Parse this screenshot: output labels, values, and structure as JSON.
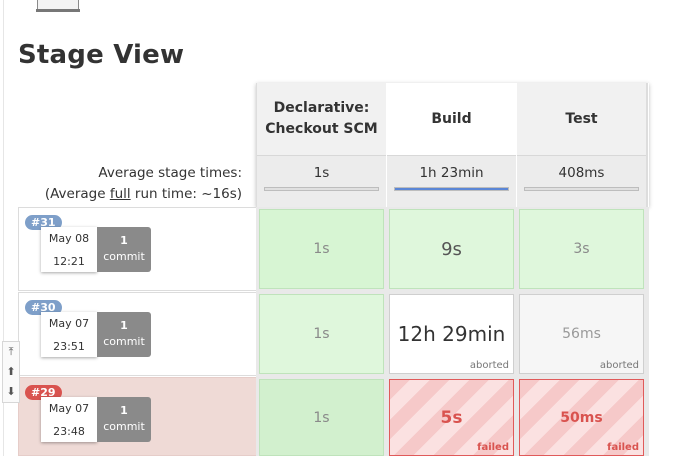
{
  "page": {
    "title": "Stage View"
  },
  "stages": [
    {
      "name_line1": "Declarative:",
      "name_line2": "Checkout SCM",
      "avg": "1s",
      "avg_fraction": 0.0
    },
    {
      "name_line1": "Build",
      "name_line2": "",
      "avg": "1h 23min",
      "avg_fraction": 1.0
    },
    {
      "name_line1": "Test",
      "name_line2": "",
      "avg": "408ms",
      "avg_fraction": 0.0
    }
  ],
  "average": {
    "label_line1": "Average stage times:",
    "full_prefix": "(Average ",
    "full_word": "full",
    "full_suffix": " run time: ~16s)"
  },
  "runs": [
    {
      "id": "#31",
      "date": "May 08",
      "time": "12:21",
      "commits_count": "1",
      "commits_label": "commit",
      "status": "success",
      "cells": [
        {
          "value": "1s",
          "status": "success",
          "note": ""
        },
        {
          "value": "9s",
          "status": "success",
          "note": ""
        },
        {
          "value": "3s",
          "status": "success",
          "note": ""
        }
      ]
    },
    {
      "id": "#30",
      "date": "May 07",
      "time": "23:51",
      "commits_count": "1",
      "commits_label": "commit",
      "status": "aborted",
      "cells": [
        {
          "value": "1s",
          "status": "success",
          "note": ""
        },
        {
          "value": "12h 29min",
          "status": "aborted",
          "note": "aborted"
        },
        {
          "value": "56ms",
          "status": "aborted",
          "note": "aborted"
        }
      ]
    },
    {
      "id": "#29",
      "date": "May 07",
      "time": "23:48",
      "commits_count": "1",
      "commits_label": "commit",
      "status": "failed",
      "cells": [
        {
          "value": "1s",
          "status": "success",
          "note": ""
        },
        {
          "value": "5s",
          "status": "failed",
          "note": "failed"
        },
        {
          "value": "50ms",
          "status": "failed",
          "note": "failed"
        }
      ]
    }
  ],
  "pager": {
    "top_icon": "scroll-top-icon",
    "up_icon": "page-up-icon",
    "down_icon": "page-down-icon"
  },
  "colors": {
    "success": "#dff7dc",
    "failed": "#d9534f",
    "aborted": "#f6f6f6",
    "progress": "#5b86d6",
    "badge": "#7e9fc9"
  }
}
